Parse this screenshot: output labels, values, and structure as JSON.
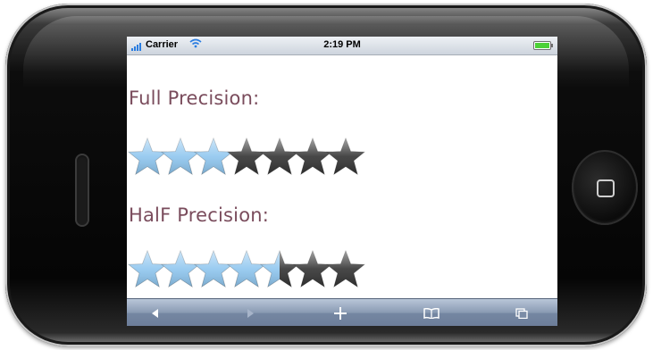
{
  "status_bar": {
    "carrier": "Carrier",
    "time": "2:19 PM",
    "battery_level": 1.0,
    "battery_color": "#4cd137"
  },
  "content": {
    "full_precision_label": "Full Precision:",
    "full_precision_rating": 3,
    "half_precision_label": "HalF Precision:",
    "half_precision_rating": 4.5,
    "max_rating": 7
  },
  "colors": {
    "star_filled": "#8fc6ef",
    "star_empty": "#333333",
    "heading": "#7a4c5c"
  },
  "toolbar": {
    "back_icon": "back-arrow-icon",
    "forward_icon": "forward-arrow-icon",
    "add_icon": "plus-icon",
    "bookmarks_icon": "bookmarks-icon",
    "pages_icon": "pages-icon"
  }
}
